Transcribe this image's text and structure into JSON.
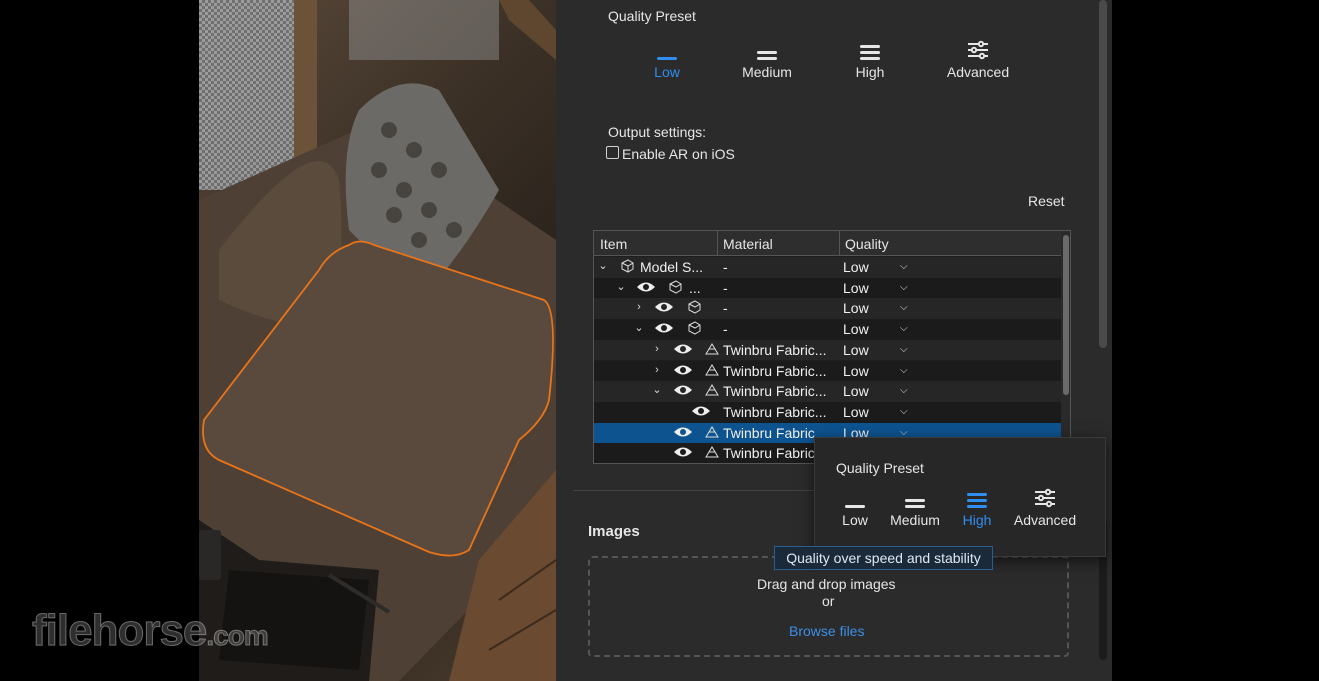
{
  "colors": {
    "accent": "#2f8ef0",
    "selection": "#0d5390",
    "panel_bg": "#2b2b2b",
    "outline": "#e8741a"
  },
  "watermark": {
    "main": "filehorse",
    "suffix": ".com"
  },
  "quality_preset": {
    "title": "Quality Preset",
    "options": [
      {
        "label": "Low",
        "icon": "one-bar-icon",
        "selected": true
      },
      {
        "label": "Medium",
        "icon": "two-bars-icon",
        "selected": false
      },
      {
        "label": "High",
        "icon": "three-bars-icon",
        "selected": false
      },
      {
        "label": "Advanced",
        "icon": "sliders-icon",
        "selected": false
      }
    ]
  },
  "output_settings": {
    "title": "Output settings:",
    "enable_ar_label": "Enable AR on iOS",
    "enable_ar_checked": false
  },
  "reset_label": "Reset",
  "table": {
    "columns": [
      "Item",
      "Material",
      "Quality"
    ],
    "rows": [
      {
        "name": "Model S...",
        "material": "-",
        "quality": "Low"
      },
      {
        "name": "...",
        "material": "-",
        "quality": "Low"
      },
      {
        "name": "",
        "material": "-",
        "quality": "Low"
      },
      {
        "name": "",
        "material": "-",
        "quality": "Low"
      },
      {
        "name": "",
        "material": "Twinbru Fabric...",
        "quality": "Low"
      },
      {
        "name": "",
        "material": "Twinbru Fabric...",
        "quality": "Low"
      },
      {
        "name": "",
        "material": "Twinbru Fabric...",
        "quality": "Low"
      },
      {
        "name": "",
        "material": "Twinbru Fabric...",
        "quality": "Low"
      },
      {
        "name": "",
        "material": "Twinbru Fabric",
        "quality": "Low"
      },
      {
        "name": "",
        "material": "Twinbru Fabric",
        "quality": ""
      }
    ]
  },
  "images": {
    "title": "Images",
    "drop_text": "Drag and drop images",
    "or_text": "or",
    "browse_label": "Browse files"
  },
  "popover": {
    "title": "Quality Preset",
    "options": [
      {
        "label": "Low",
        "selected": false
      },
      {
        "label": "Medium",
        "selected": false
      },
      {
        "label": "High",
        "selected": true
      },
      {
        "label": "Advanced",
        "selected": false
      }
    ],
    "tooltip": "Quality over speed and stability"
  }
}
